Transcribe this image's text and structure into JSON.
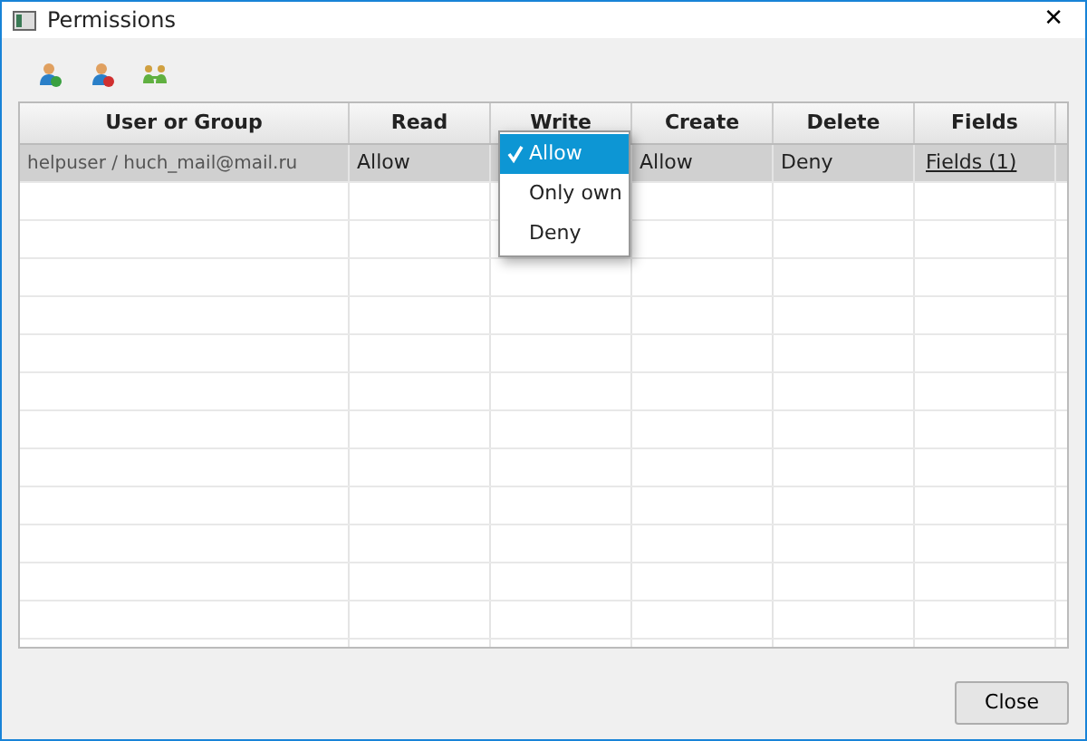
{
  "window": {
    "title": "Permissions",
    "close": "✕"
  },
  "toolbar": [
    {
      "kind": "add-user"
    },
    {
      "kind": "remove-user"
    },
    {
      "kind": "group"
    }
  ],
  "table": {
    "columns": [
      "User or Group",
      "Read",
      "Write",
      "Create",
      "Delete",
      "Fields"
    ],
    "rows": [
      {
        "selected": true,
        "cells": [
          {
            "kind": "text",
            "text": "helpuser / huch_mail@mail.ru"
          },
          {
            "kind": "text",
            "text": "Allow"
          },
          {
            "kind": "covered"
          },
          {
            "kind": "text",
            "text": "Allow"
          },
          {
            "kind": "text",
            "text": "Deny"
          },
          {
            "kind": "link",
            "text": "Fields (1)"
          }
        ]
      }
    ]
  },
  "dropdown": {
    "items": [
      {
        "label": "Allow",
        "selected": true
      },
      {
        "label": "Only own",
        "selected": false
      },
      {
        "label": "Deny",
        "selected": false
      }
    ]
  },
  "buttons": [
    {
      "label": "Close"
    }
  ]
}
